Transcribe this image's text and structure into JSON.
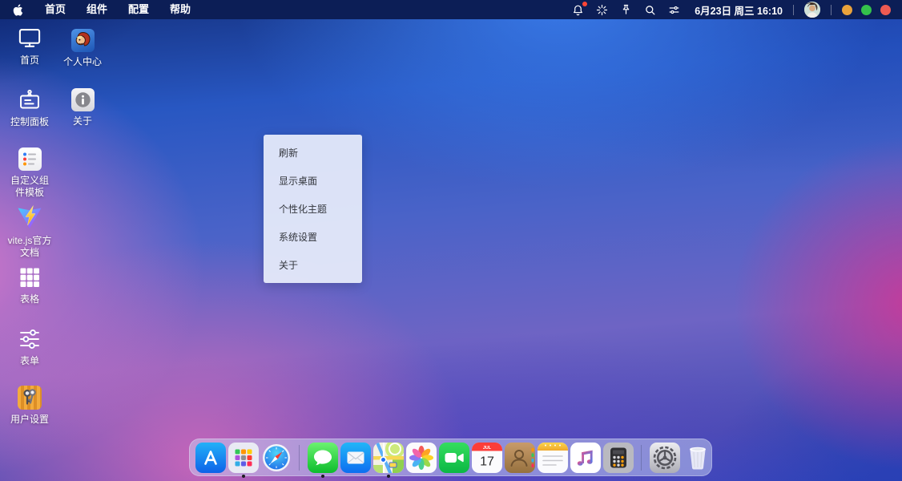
{
  "menubar": {
    "apple_logo": "apple",
    "menus": [
      {
        "label": "首页"
      },
      {
        "label": "组件"
      },
      {
        "label": "配置"
      },
      {
        "label": "帮助"
      }
    ],
    "status": {
      "icons": [
        "bell",
        "sparkle",
        "pin",
        "search",
        "control-sliders"
      ],
      "bell_has_red_badge": true,
      "datetime": "6月23日 周三 16:10",
      "traffic_lights": {
        "yellow": "#e9a23b",
        "green": "#34c24b",
        "red": "#ee5a52"
      }
    },
    "background_color": "#0c1e56"
  },
  "desktop_icons": [
    {
      "label": "首页",
      "icon": "monitor"
    },
    {
      "label": "个人中心",
      "icon": "monkey-avatar-app"
    },
    {
      "label": "控制面板",
      "icon": "control-board"
    },
    {
      "label": "关于",
      "icon": "info-app"
    },
    {
      "label": "自定义组件模板",
      "icon": "reminders-list-app"
    },
    {
      "label": "vite.js官方文档",
      "icon": "vite-logo"
    },
    {
      "label": "表格",
      "icon": "grid"
    },
    {
      "label": "表单",
      "icon": "sliders"
    },
    {
      "label": "用户设置",
      "icon": "keychain-app"
    }
  ],
  "context_menu": {
    "items": [
      {
        "label": "刷新"
      },
      {
        "label": "显示桌面"
      },
      {
        "label": "个性化主题"
      },
      {
        "label": "系统设置"
      },
      {
        "label": "关于"
      }
    ]
  },
  "dock": {
    "items": [
      {
        "name": "app-store",
        "running": false
      },
      {
        "name": "launchpad",
        "running": true
      },
      {
        "name": "safari",
        "running": false
      },
      {
        "name": "messages",
        "running": true
      },
      {
        "name": "mail",
        "running": false
      },
      {
        "name": "maps",
        "running": true
      },
      {
        "name": "photos",
        "running": false
      },
      {
        "name": "facetime",
        "running": false
      },
      {
        "name": "calendar",
        "running": false
      },
      {
        "name": "contacts",
        "running": false
      },
      {
        "name": "notes",
        "running": false
      },
      {
        "name": "music",
        "running": false
      },
      {
        "name": "calculator",
        "running": false
      },
      {
        "name": "settings",
        "running": false
      },
      {
        "name": "trash",
        "running": false
      }
    ],
    "calendar": {
      "month": "JUL",
      "day": "17"
    }
  }
}
